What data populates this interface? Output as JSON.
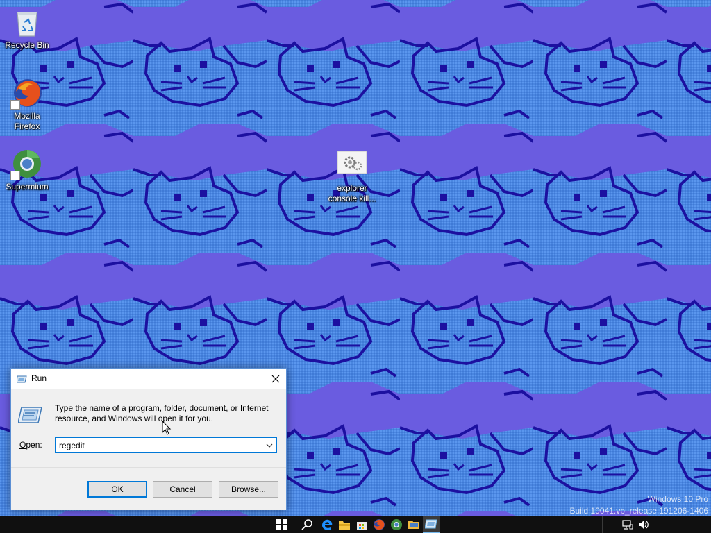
{
  "desktop": {
    "icons": [
      {
        "label": "Recycle Bin",
        "icon": "recycle-bin-icon"
      },
      {
        "label": "Mozilla Firefox",
        "icon": "firefox-icon"
      },
      {
        "label": "Supermium",
        "icon": "supermium-icon"
      },
      {
        "label": "explorer console kill...",
        "icon": "gears-icon"
      }
    ],
    "wallpaper_colors": {
      "light": "#4a86e0",
      "dark": "#6a5ce0",
      "outline": "#1c10a0"
    }
  },
  "watermark": {
    "line1": "Windows 10 Pro",
    "line2": "Build 19041.vb_release.191206-1406"
  },
  "run_dialog": {
    "title": "Run",
    "description": "Type the name of a program, folder, document, or Internet resource, and Windows will open it for you.",
    "open_label_prefix": "",
    "open_label_access": "O",
    "open_label_rest": "pen:",
    "input_value": "regedit",
    "ok_label": "OK",
    "cancel_label": "Cancel",
    "browse_label": "Browse...",
    "accent_color": "#0078d7"
  },
  "taskbar": {
    "items": [
      "windows-start-icon",
      "search-icon",
      "edge-icon",
      "file-explorer-icon",
      "store-icon",
      "firefox-icon",
      "supermium-icon",
      "folder-icon",
      "run-icon"
    ],
    "tray": [
      "network-icon",
      "volume-icon"
    ]
  }
}
